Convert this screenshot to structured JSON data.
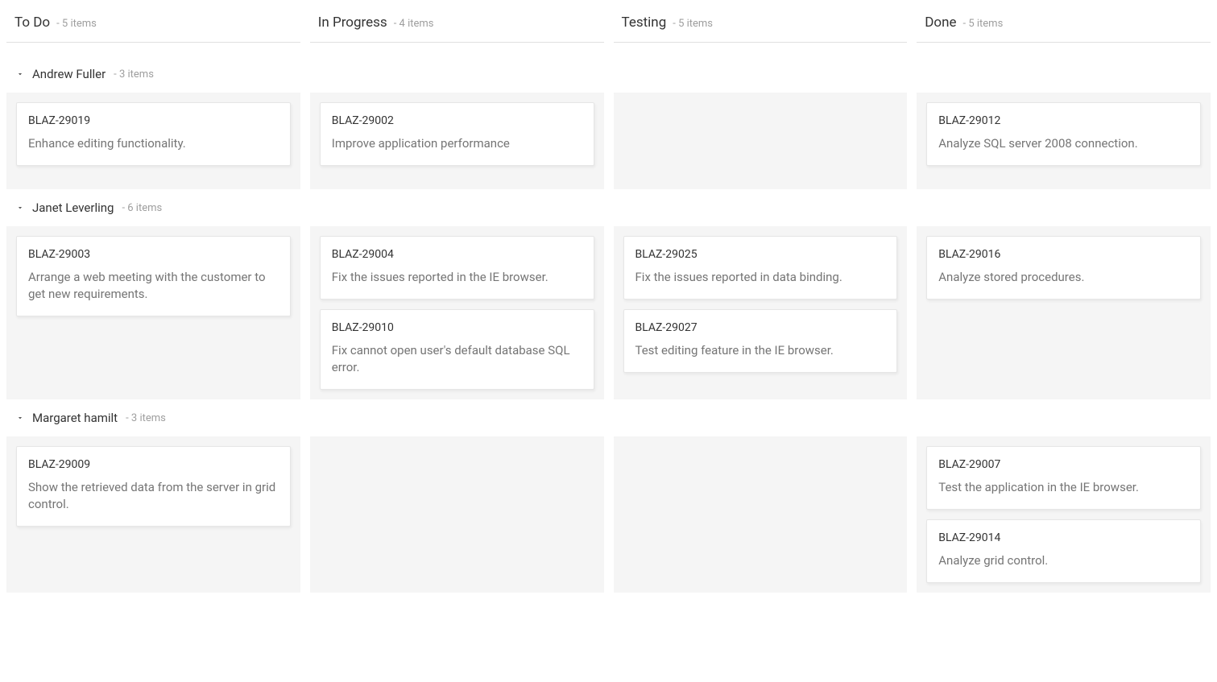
{
  "itemsSuffix": "items",
  "columns": [
    {
      "key": "todo",
      "title": "To Do",
      "count": "- 5 items"
    },
    {
      "key": "inprogress",
      "title": "In Progress",
      "count": "- 4 items"
    },
    {
      "key": "testing",
      "title": "Testing",
      "count": "- 5 items"
    },
    {
      "key": "done",
      "title": "Done",
      "count": "- 5 items"
    }
  ],
  "swimlanes": [
    {
      "key": "andrew-fuller",
      "name": "Andrew Fuller",
      "count": "- 3 items",
      "cells": {
        "todo": [
          {
            "id": "BLAZ-29019",
            "summary": "Enhance editing functionality."
          }
        ],
        "inprogress": [
          {
            "id": "BLAZ-29002",
            "summary": "Improve application performance"
          }
        ],
        "testing": [],
        "done": [
          {
            "id": "BLAZ-29012",
            "summary": "Analyze SQL server 2008 connection."
          }
        ]
      }
    },
    {
      "key": "janet-leverling",
      "name": "Janet Leverling",
      "count": "- 6 items",
      "cells": {
        "todo": [
          {
            "id": "BLAZ-29003",
            "summary": "Arrange a web meeting with the customer to get new requirements."
          }
        ],
        "inprogress": [
          {
            "id": "BLAZ-29004",
            "summary": "Fix the issues reported in the IE browser."
          },
          {
            "id": "BLAZ-29010",
            "summary": "Fix cannot open user's default database SQL error."
          }
        ],
        "testing": [
          {
            "id": "BLAZ-29025",
            "summary": "Fix the issues reported in data binding."
          },
          {
            "id": "BLAZ-29027",
            "summary": "Test editing feature in the IE browser."
          }
        ],
        "done": [
          {
            "id": "BLAZ-29016",
            "summary": "Analyze stored procedures."
          }
        ]
      }
    },
    {
      "key": "margaret-hamilt",
      "name": "Margaret hamilt",
      "count": "- 3 items",
      "cells": {
        "todo": [
          {
            "id": "BLAZ-29009",
            "summary": "Show the retrieved data from the server in grid control."
          }
        ],
        "inprogress": [],
        "testing": [],
        "done": [
          {
            "id": "BLAZ-29007",
            "summary": "Test the application in the IE browser."
          },
          {
            "id": "BLAZ-29014",
            "summary": "Analyze grid control."
          }
        ]
      }
    }
  ]
}
